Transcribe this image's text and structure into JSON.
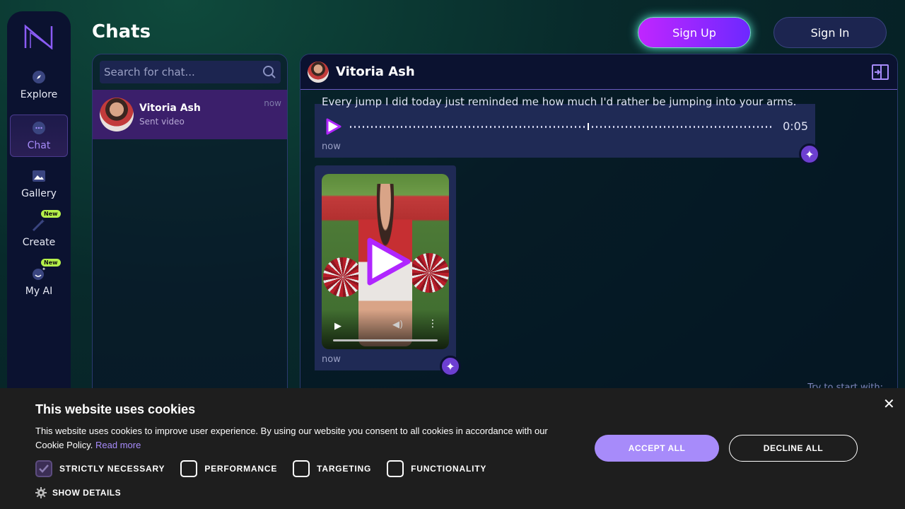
{
  "app": {
    "page_title": "Chats",
    "accent": "#a78bfa"
  },
  "header": {
    "signup_label": "Sign Up",
    "signin_label": "Sign In"
  },
  "sidebar": {
    "items": [
      {
        "label": "Explore",
        "icon": "compass-icon"
      },
      {
        "label": "Chat",
        "icon": "chat-icon",
        "active": true
      },
      {
        "label": "Gallery",
        "icon": "image-icon"
      },
      {
        "label": "Create",
        "icon": "magic-wand-icon",
        "badge": "New"
      },
      {
        "label": "My AI",
        "icon": "ai-face-icon",
        "badge": "New"
      }
    ]
  },
  "chat_list": {
    "search_placeholder": "Search for chat...",
    "items": [
      {
        "name": "Vitoria Ash",
        "subtitle": "Sent video",
        "time": "now"
      }
    ]
  },
  "conversation": {
    "name": "Vitoria Ash",
    "messages": [
      {
        "type": "audio",
        "text": "Every jump I did today just reminded me how much I'd rather be jumping into your arms.",
        "duration": "0:05",
        "time": "now"
      },
      {
        "type": "video",
        "time": "now"
      }
    ],
    "try_text": "Try to start with:"
  },
  "cookie_banner": {
    "title": "This website uses cookies",
    "body": "This website uses cookies to improve user experience. By using our website you consent to all cookies in accordance with our Cookie Policy.",
    "read_more": "Read more",
    "accept_label": "ACCEPT ALL",
    "decline_label": "DECLINE ALL",
    "options": [
      {
        "label": "STRICTLY NECESSARY",
        "checked": true
      },
      {
        "label": "PERFORMANCE",
        "checked": false
      },
      {
        "label": "TARGETING",
        "checked": false
      },
      {
        "label": "FUNCTIONALITY",
        "checked": false
      }
    ],
    "show_details": "SHOW DETAILS"
  }
}
